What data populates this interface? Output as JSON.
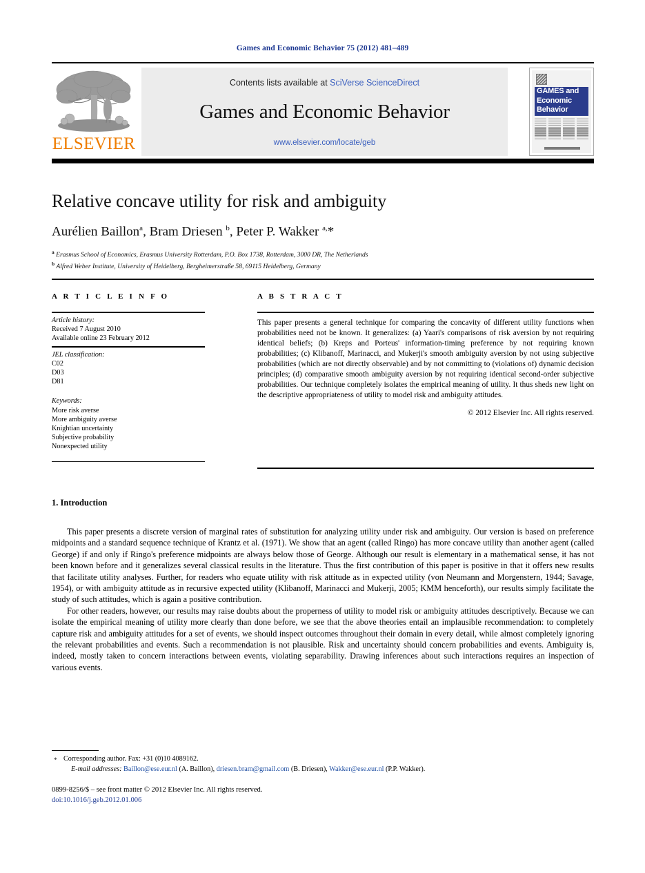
{
  "running_head": "Games and Economic Behavior 75 (2012) 481–489",
  "masthead": {
    "contents_prefix": "Contents lists available at ",
    "sciverse_link": "SciVerse ScienceDirect",
    "journal_title": "Games and Economic Behavior",
    "journal_url": "www.elsevier.com/locate/geb",
    "publisher_name": "ELSEVIER",
    "cover": {
      "line1": "GAMES and",
      "line2": "Economic",
      "line3": "Behavior"
    }
  },
  "article": {
    "title": "Relative concave utility for risk and ambiguity",
    "authors_html": "Aurélien Baillon <sup>a</sup>, Bram Driesen <sup>b</sup>, Peter P. Wakker <sup>a,</sup>*",
    "affiliations": [
      {
        "marker": "a",
        "text": "Erasmus School of Economics, Erasmus University Rotterdam, P.O. Box 1738, Rotterdam, 3000 DR, The Netherlands"
      },
      {
        "marker": "b",
        "text": "Alfred Weber Institute, University of Heidelberg, Bergheimerstraße 58, 69115 Heidelberg, Germany"
      }
    ]
  },
  "info": {
    "heading": "A R T I C L E     I N F O",
    "history_label": "Article history:",
    "history": [
      "Received 7 August 2010",
      "Available online 23 February 2012"
    ],
    "jel_label": "JEL classification:",
    "jel": [
      "C02",
      "D03",
      "D81"
    ],
    "keywords_label": "Keywords:",
    "keywords": [
      "More risk averse",
      "More ambiguity averse",
      "Knightian uncertainty",
      "Subjective probability",
      "Nonexpected utility"
    ]
  },
  "abstract": {
    "heading": "A B S T R A C T",
    "text": "This paper presents a general technique for comparing the concavity of different utility functions when probabilities need not be known. It generalizes: (a) Yaari's comparisons of risk aversion by not requiring identical beliefs; (b) Kreps and Porteus' information-timing preference by not requiring known probabilities; (c) Klibanoff, Marinacci, and Mukerji's smooth ambiguity aversion by not using subjective probabilities (which are not directly observable) and by not committing to (violations of) dynamic decision principles; (d) comparative smooth ambiguity aversion by not requiring identical second-order subjective probabilities. Our technique completely isolates the empirical meaning of utility. It thus sheds new light on the descriptive appropriateness of utility to model risk and ambiguity attitudes.",
    "copyright": "© 2012 Elsevier Inc. All rights reserved."
  },
  "body": {
    "section_heading": "1. Introduction",
    "paragraphs": [
      "This paper presents a discrete version of marginal rates of substitution for analyzing utility under risk and ambiguity. Our version is based on preference midpoints and a standard sequence technique of Krantz et al. (1971). We show that an agent (called Ringo) has more concave utility than another agent (called George) if and only if Ringo's preference midpoints are always below those of George. Although our result is elementary in a mathematical sense, it has not been known before and it generalizes several classical results in the literature. Thus the first contribution of this paper is positive in that it offers new results that facilitate utility analyses. Further, for readers who equate utility with risk attitude as in expected utility (von Neumann and Morgenstern, 1944; Savage, 1954), or with ambiguity attitude as in recursive expected utility (Klibanoff, Marinacci and Mukerji, 2005; KMM henceforth), our results simply facilitate the study of such attitudes, which is again a positive contribution.",
      "For other readers, however, our results may raise doubts about the properness of utility to model risk or ambiguity attitudes descriptively. Because we can isolate the empirical meaning of utility more clearly than done before, we see that the above theories entail an implausible recommendation: to completely capture risk and ambiguity attitudes for a set of events, we should inspect outcomes throughout their domain in every detail, while almost completely ignoring the relevant probabilities and events. Such a recommendation is not plausible. Risk and uncertainty should concern probabilities and events. Ambiguity is, indeed, mostly taken to concern interactions between events, violating separability. Drawing inferences about such interactions requires an inspection of various events."
    ]
  },
  "footer": {
    "corresponding": "Corresponding author. Fax: +31 (0)10 4089162.",
    "email_label": "E-mail addresses:",
    "emails": [
      {
        "address": "Baillon@ese.eur.nl",
        "person": "(A. Baillon)"
      },
      {
        "address": "driesen.bram@gmail.com",
        "person": "(B. Driesen)"
      },
      {
        "address": "Wakker@ese.eur.nl",
        "person": "(P.P. Wakker)"
      }
    ],
    "issn_line": "0899-8256/$ – see front matter  © 2012 Elsevier Inc. All rights reserved.",
    "doi_line": "doi:10.1016/j.geb.2012.01.006"
  },
  "colors": {
    "elsevier_orange": "#ef7d00",
    "link_blue": "#3a5fbf",
    "running_head_blue": "#1f3a93",
    "cover_blue": "#2b3c8c"
  }
}
